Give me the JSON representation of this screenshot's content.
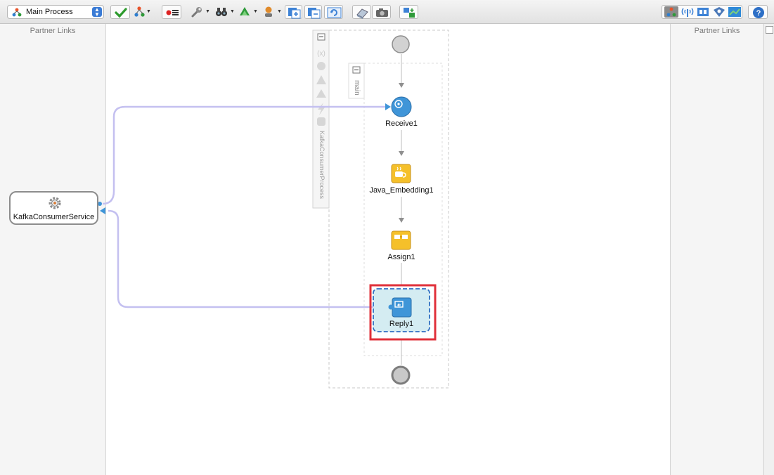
{
  "toolbar": {
    "process_select": "Main Process"
  },
  "left_panel": {
    "title": "Partner Links"
  },
  "right_panel": {
    "title": "Partner Links"
  },
  "partner_link": {
    "name": "KafkaConsumerService"
  },
  "process": {
    "scope_label": "KafkaConsumerProcess",
    "sequence_label": "main",
    "activities": [
      {
        "name": "Receive1",
        "type": "receive"
      },
      {
        "name": "Java_Embedding1",
        "type": "java-embedding"
      },
      {
        "name": "Assign1",
        "type": "assign"
      },
      {
        "name": "Reply1",
        "type": "reply",
        "selected": true
      }
    ]
  },
  "colors": {
    "link_line": "#c4c0f0",
    "selection_highlight": "#e0303a",
    "selected_fill": "#d4ecf2",
    "selected_border": "#2f6fc2",
    "activity_yellow": "#f5c02a",
    "activity_blue": "#3f95d8"
  }
}
